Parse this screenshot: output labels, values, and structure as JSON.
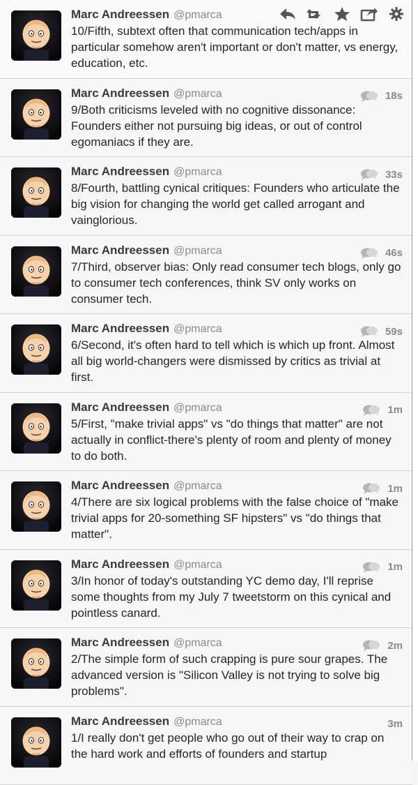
{
  "author": {
    "name": "Marc Andreessen",
    "handle": "@pmarca"
  },
  "colors": {
    "background": "#f7f7f7",
    "name": "#3a3a3a",
    "muted": "#8a8a8a",
    "divider": "#d0d0d0"
  },
  "first_tweet_actions": [
    "reply-icon",
    "retweet-icon",
    "favorite-icon",
    "share-icon",
    "gear-icon"
  ],
  "tweets": [
    {
      "text": "10/Fifth, subtext often that communication tech/apps in particular somehow aren't important or don't matter, vs energy, education, etc.",
      "time": ""
    },
    {
      "text": "9/Both criticisms leveled with no cognitive dissonance: Founders either not pursuing big ideas, or out of control egomaniacs if they are.",
      "time": "18s"
    },
    {
      "text": "8/Fourth, battling cynical critiques: Founders who articulate the big vision for changing the world get called arrogant and vainglorious.",
      "time": "33s"
    },
    {
      "text": "7/Third, observer bias: Only read consumer tech blogs, only go to consumer tech conferences, think SV only works on consumer tech.",
      "time": "46s"
    },
    {
      "text": "6/Second, it's often hard to tell which is which up front. Almost all big world-changers were dismissed by critics as trivial at first.",
      "time": "59s"
    },
    {
      "text": "5/First, \"make trivial apps\" vs \"do things that matter\" are not actually in conflict-there's plenty of room and plenty of money to do both.",
      "time": "1m"
    },
    {
      "text": "4/There are six logical problems with the false choice of \"make trivial apps for 20-something SF hipsters\" vs \"do things that matter\".",
      "time": "1m"
    },
    {
      "text": "3/In honor of today's outstanding YC demo day, I'll reprise some thoughts from my July 7 tweetstorm on this cynical and pointless canard.",
      "time": "1m"
    },
    {
      "text": "2/The simple form of such crapping is pure sour grapes. The advanced version is \"Silicon Valley is not trying to solve big problems\".",
      "time": "2m"
    },
    {
      "text": "1/I really don't get people who go out of their way to crap on the hard work and efforts of founders and startup",
      "time": "3m"
    }
  ]
}
